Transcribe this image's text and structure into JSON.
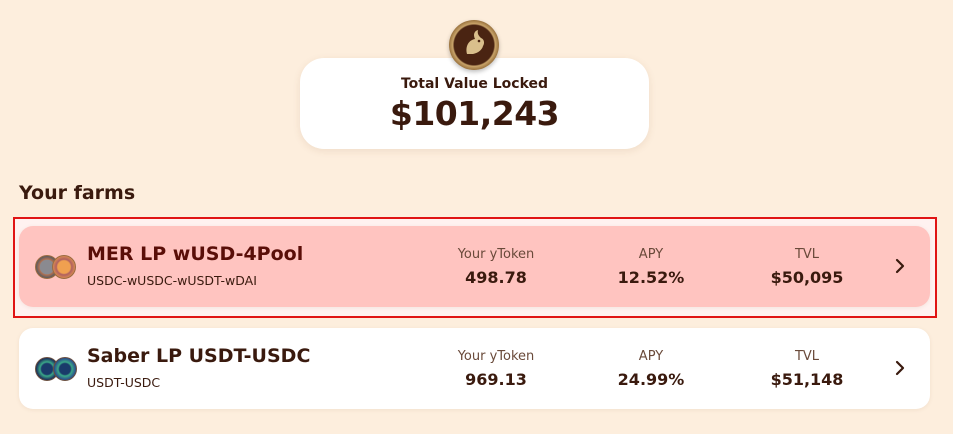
{
  "header": {
    "logo_icon": "rabbit-logo-icon",
    "tvl_label": "Total Value Locked",
    "tvl_value": "$101,243"
  },
  "section": {
    "title": "Your farms"
  },
  "farms": [
    {
      "name": "MER LP wUSD-4Pool",
      "pair": "USDC-wUSDC-wUSDT-wDAI",
      "ytoken_label": "Your yToken",
      "ytoken_value": "498.78",
      "apy_label": "APY",
      "apy_value": "12.52%",
      "tvl_label": "TVL",
      "tvl_value": "$50,095",
      "highlighted": true
    },
    {
      "name": "Saber LP USDT-USDC",
      "pair": "USDT-USDC",
      "ytoken_label": "Your yToken",
      "ytoken_value": "969.13",
      "apy_label": "APY",
      "apy_value": "24.99%",
      "tvl_label": "TVL",
      "tvl_value": "$51,148",
      "highlighted": false
    }
  ],
  "colors": {
    "background": "#fdeedd",
    "text": "#3a1a0e",
    "highlight_border": "#e01414",
    "highlight_fill": "#ffc4c0"
  }
}
